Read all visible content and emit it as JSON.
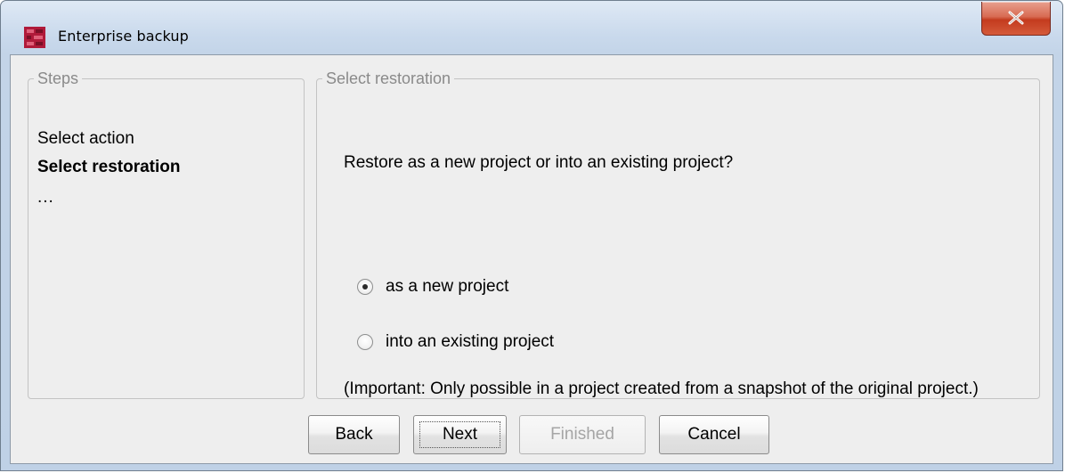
{
  "window": {
    "title": "Enterprise backup",
    "close_symbol": "x",
    "app_icon": "app-logo-icon",
    "accent_color": "#c43b1e"
  },
  "steps": {
    "legend": "Steps",
    "items": [
      {
        "label": "Select action",
        "current": false
      },
      {
        "label": "Select restoration",
        "current": true
      },
      {
        "label": "...",
        "current": false
      }
    ]
  },
  "restoration": {
    "legend": "Select restoration",
    "question": "Restore as a new project or into an existing project?",
    "options": [
      {
        "label": "as a new project",
        "selected": true
      },
      {
        "label": "into an existing project",
        "selected": false
      }
    ],
    "note": "(Important: Only possible in a project created from a snapshot of the original project.)"
  },
  "buttons": {
    "back": "Back",
    "next": "Next",
    "finished": "Finished",
    "cancel": "Cancel"
  }
}
